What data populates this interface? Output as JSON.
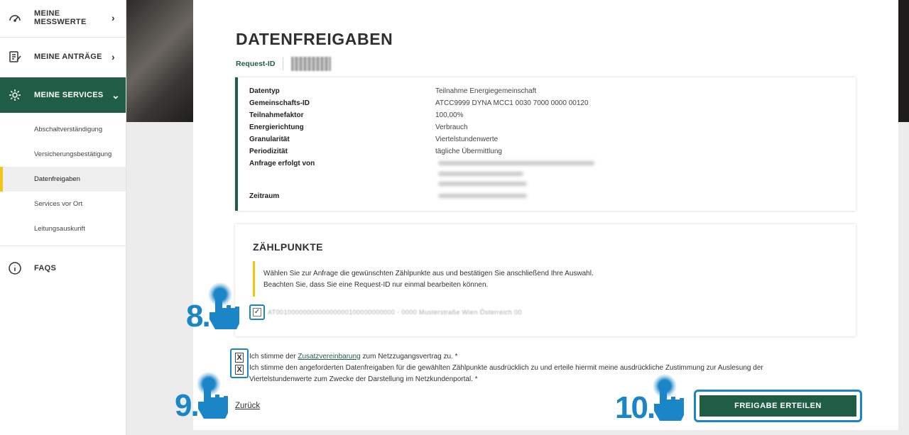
{
  "sidebar": {
    "items": [
      {
        "label": "MEINE MESSWERTE",
        "chevron": "›"
      },
      {
        "label": "MEINE ANTRÄGE",
        "chevron": "›"
      },
      {
        "label": "MEINE SERVICES",
        "chevron": "⌄"
      }
    ],
    "sub_items": [
      {
        "label": "Abschaltverständigung"
      },
      {
        "label": "Versicherungsbestätigung"
      },
      {
        "label": "Datenfreigaben"
      },
      {
        "label": "Services vor Ort"
      },
      {
        "label": "Leitungsauskunft"
      }
    ],
    "faqs": "FAQS"
  },
  "page": {
    "title": "DATENFREIGABEN",
    "request_id_label": "Request-ID"
  },
  "details": {
    "rows": [
      {
        "key": "Datentyp",
        "value": "Teilnahme Energiegemeinschaft"
      },
      {
        "key": "Gemeinschafts-ID",
        "value": "ATCC9999 DYNA MCC1 0030 7000 0000 00120"
      },
      {
        "key": "Teilnahmefaktor",
        "value": "100,00%"
      },
      {
        "key": "Energierichtung",
        "value": "Verbrauch"
      },
      {
        "key": "Granularität",
        "value": "Viertelstundenwerte"
      },
      {
        "key": "Periodizität",
        "value": "tägliche Übermittlung"
      },
      {
        "key": "Anfrage erfolgt von",
        "value": ""
      },
      {
        "key": "Zeitraum",
        "value": ""
      }
    ]
  },
  "zaehlpunkte": {
    "heading": "ZÄHLPUNKTE",
    "hint_line1": "Wählen Sie zur Anfrage die gewünschten Zählpunkte aus und bestätigen Sie anschließend Ihre Auswahl.",
    "hint_line2": "Beachten Sie, dass Sie eine Request-ID nur einmal bearbeiten können.",
    "checkbox_mark": "✓",
    "item_text": "AT0010000000000000000100000000000 - 0000 Musterstraße Wien Österreich 00"
  },
  "consent": {
    "mark": "X",
    "line1_pre": "Ich stimme der",
    "line1_link": "Zusatzvereinbarung",
    "line1_post": "zum Netzzugangsvertrag zu. *",
    "line2": "Ich stimme den angeforderten Datenfreigaben für die gewählten Zählpunkte ausdrücklich zu und erteile hiermit meine ausdrückliche Zustimmung zur Auslesung der",
    "line3": "Viertelstundenwerte zum Zwecke der Darstellung im Netzkundenportal. *"
  },
  "actions": {
    "back": "Zurück",
    "submit": "FREIGABE ERTEILEN"
  },
  "steps": [
    "8.",
    "9.",
    "10."
  ],
  "colors": {
    "brand_green": "#1f5e45",
    "accent_yellow": "#f0c419",
    "callout_blue": "#1a86c7"
  }
}
